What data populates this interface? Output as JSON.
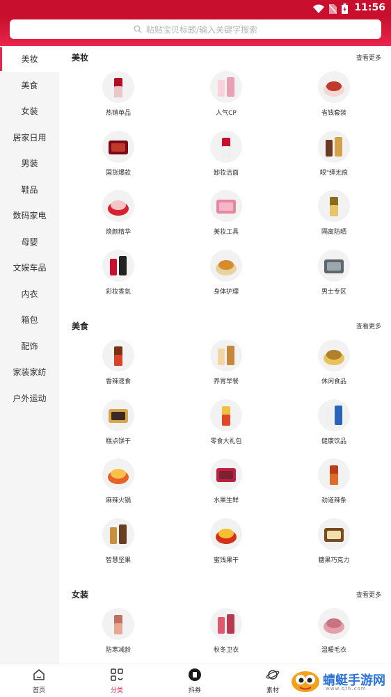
{
  "status": {
    "time": "11:56"
  },
  "search": {
    "placeholder": "粘贴宝贝标题/输入关键字搜索"
  },
  "sidebar": {
    "active": "美妆",
    "items": [
      "美妆",
      "美食",
      "女装",
      "居家日用",
      "男装",
      "鞋品",
      "数码家电",
      "母婴",
      "文娱车品",
      "内衣",
      "箱包",
      "配饰",
      "家装家纺",
      "户外运动"
    ]
  },
  "sections": [
    {
      "title": "美妆",
      "more": "查看更多",
      "items": [
        "热销单品",
        "人气CP",
        "省钱套装",
        "国货爆款",
        "卸妆洁面",
        "眼\"绎无痕",
        "焕颜精华",
        "美妆工具",
        "隔离防晒",
        "彩妆香氛",
        "身体护理",
        "男士专区"
      ]
    },
    {
      "title": "美食",
      "more": "查看更多",
      "items": [
        "香辣速食",
        "养胃早餐",
        "休闲食品",
        "糕点饼干",
        "零食大礼包",
        "健康饮品",
        "麻辣火锅",
        "水果生鲜",
        "劲道辣条",
        "智慧坚果",
        "蜜饯果干",
        "糖果巧克力"
      ]
    },
    {
      "title": "女装",
      "more": "查看更多",
      "items": [
        "防寒减龄",
        "秋冬卫衣",
        "温暖毛衣"
      ]
    }
  ],
  "tabbar": [
    {
      "label": "首页",
      "icon": "home-icon"
    },
    {
      "label": "分类",
      "icon": "category-icon",
      "active": true
    },
    {
      "label": "抖券",
      "icon": "coupon-icon"
    },
    {
      "label": "素材",
      "icon": "planet-icon"
    }
  ],
  "watermark": {
    "name": "蜻蜓手游网",
    "url": "www.qt6.com"
  },
  "colors": {
    "brand": "#e8244a",
    "header": "#c8102e"
  }
}
